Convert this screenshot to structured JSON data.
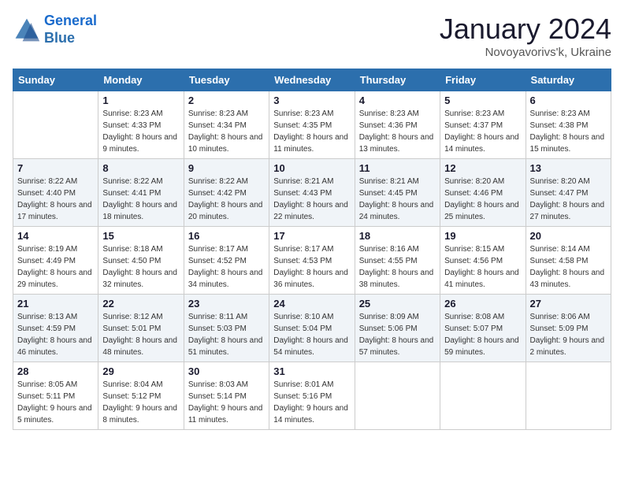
{
  "header": {
    "logo_line1": "General",
    "logo_line2": "Blue",
    "month": "January 2024",
    "location": "Novoyavorivs'k, Ukraine"
  },
  "weekdays": [
    "Sunday",
    "Monday",
    "Tuesday",
    "Wednesday",
    "Thursday",
    "Friday",
    "Saturday"
  ],
  "weeks": [
    [
      {
        "day": "",
        "sunrise": "",
        "sunset": "",
        "daylight": ""
      },
      {
        "day": "1",
        "sunrise": "Sunrise: 8:23 AM",
        "sunset": "Sunset: 4:33 PM",
        "daylight": "Daylight: 8 hours and 9 minutes."
      },
      {
        "day": "2",
        "sunrise": "Sunrise: 8:23 AM",
        "sunset": "Sunset: 4:34 PM",
        "daylight": "Daylight: 8 hours and 10 minutes."
      },
      {
        "day": "3",
        "sunrise": "Sunrise: 8:23 AM",
        "sunset": "Sunset: 4:35 PM",
        "daylight": "Daylight: 8 hours and 11 minutes."
      },
      {
        "day": "4",
        "sunrise": "Sunrise: 8:23 AM",
        "sunset": "Sunset: 4:36 PM",
        "daylight": "Daylight: 8 hours and 13 minutes."
      },
      {
        "day": "5",
        "sunrise": "Sunrise: 8:23 AM",
        "sunset": "Sunset: 4:37 PM",
        "daylight": "Daylight: 8 hours and 14 minutes."
      },
      {
        "day": "6",
        "sunrise": "Sunrise: 8:23 AM",
        "sunset": "Sunset: 4:38 PM",
        "daylight": "Daylight: 8 hours and 15 minutes."
      }
    ],
    [
      {
        "day": "7",
        "sunrise": "Sunrise: 8:22 AM",
        "sunset": "Sunset: 4:40 PM",
        "daylight": "Daylight: 8 hours and 17 minutes."
      },
      {
        "day": "8",
        "sunrise": "Sunrise: 8:22 AM",
        "sunset": "Sunset: 4:41 PM",
        "daylight": "Daylight: 8 hours and 18 minutes."
      },
      {
        "day": "9",
        "sunrise": "Sunrise: 8:22 AM",
        "sunset": "Sunset: 4:42 PM",
        "daylight": "Daylight: 8 hours and 20 minutes."
      },
      {
        "day": "10",
        "sunrise": "Sunrise: 8:21 AM",
        "sunset": "Sunset: 4:43 PM",
        "daylight": "Daylight: 8 hours and 22 minutes."
      },
      {
        "day": "11",
        "sunrise": "Sunrise: 8:21 AM",
        "sunset": "Sunset: 4:45 PM",
        "daylight": "Daylight: 8 hours and 24 minutes."
      },
      {
        "day": "12",
        "sunrise": "Sunrise: 8:20 AM",
        "sunset": "Sunset: 4:46 PM",
        "daylight": "Daylight: 8 hours and 25 minutes."
      },
      {
        "day": "13",
        "sunrise": "Sunrise: 8:20 AM",
        "sunset": "Sunset: 4:47 PM",
        "daylight": "Daylight: 8 hours and 27 minutes."
      }
    ],
    [
      {
        "day": "14",
        "sunrise": "Sunrise: 8:19 AM",
        "sunset": "Sunset: 4:49 PM",
        "daylight": "Daylight: 8 hours and 29 minutes."
      },
      {
        "day": "15",
        "sunrise": "Sunrise: 8:18 AM",
        "sunset": "Sunset: 4:50 PM",
        "daylight": "Daylight: 8 hours and 32 minutes."
      },
      {
        "day": "16",
        "sunrise": "Sunrise: 8:17 AM",
        "sunset": "Sunset: 4:52 PM",
        "daylight": "Daylight: 8 hours and 34 minutes."
      },
      {
        "day": "17",
        "sunrise": "Sunrise: 8:17 AM",
        "sunset": "Sunset: 4:53 PM",
        "daylight": "Daylight: 8 hours and 36 minutes."
      },
      {
        "day": "18",
        "sunrise": "Sunrise: 8:16 AM",
        "sunset": "Sunset: 4:55 PM",
        "daylight": "Daylight: 8 hours and 38 minutes."
      },
      {
        "day": "19",
        "sunrise": "Sunrise: 8:15 AM",
        "sunset": "Sunset: 4:56 PM",
        "daylight": "Daylight: 8 hours and 41 minutes."
      },
      {
        "day": "20",
        "sunrise": "Sunrise: 8:14 AM",
        "sunset": "Sunset: 4:58 PM",
        "daylight": "Daylight: 8 hours and 43 minutes."
      }
    ],
    [
      {
        "day": "21",
        "sunrise": "Sunrise: 8:13 AM",
        "sunset": "Sunset: 4:59 PM",
        "daylight": "Daylight: 8 hours and 46 minutes."
      },
      {
        "day": "22",
        "sunrise": "Sunrise: 8:12 AM",
        "sunset": "Sunset: 5:01 PM",
        "daylight": "Daylight: 8 hours and 48 minutes."
      },
      {
        "day": "23",
        "sunrise": "Sunrise: 8:11 AM",
        "sunset": "Sunset: 5:03 PM",
        "daylight": "Daylight: 8 hours and 51 minutes."
      },
      {
        "day": "24",
        "sunrise": "Sunrise: 8:10 AM",
        "sunset": "Sunset: 5:04 PM",
        "daylight": "Daylight: 8 hours and 54 minutes."
      },
      {
        "day": "25",
        "sunrise": "Sunrise: 8:09 AM",
        "sunset": "Sunset: 5:06 PM",
        "daylight": "Daylight: 8 hours and 57 minutes."
      },
      {
        "day": "26",
        "sunrise": "Sunrise: 8:08 AM",
        "sunset": "Sunset: 5:07 PM",
        "daylight": "Daylight: 8 hours and 59 minutes."
      },
      {
        "day": "27",
        "sunrise": "Sunrise: 8:06 AM",
        "sunset": "Sunset: 5:09 PM",
        "daylight": "Daylight: 9 hours and 2 minutes."
      }
    ],
    [
      {
        "day": "28",
        "sunrise": "Sunrise: 8:05 AM",
        "sunset": "Sunset: 5:11 PM",
        "daylight": "Daylight: 9 hours and 5 minutes."
      },
      {
        "day": "29",
        "sunrise": "Sunrise: 8:04 AM",
        "sunset": "Sunset: 5:12 PM",
        "daylight": "Daylight: 9 hours and 8 minutes."
      },
      {
        "day": "30",
        "sunrise": "Sunrise: 8:03 AM",
        "sunset": "Sunset: 5:14 PM",
        "daylight": "Daylight: 9 hours and 11 minutes."
      },
      {
        "day": "31",
        "sunrise": "Sunrise: 8:01 AM",
        "sunset": "Sunset: 5:16 PM",
        "daylight": "Daylight: 9 hours and 14 minutes."
      },
      {
        "day": "",
        "sunrise": "",
        "sunset": "",
        "daylight": ""
      },
      {
        "day": "",
        "sunrise": "",
        "sunset": "",
        "daylight": ""
      },
      {
        "day": "",
        "sunrise": "",
        "sunset": "",
        "daylight": ""
      }
    ]
  ]
}
